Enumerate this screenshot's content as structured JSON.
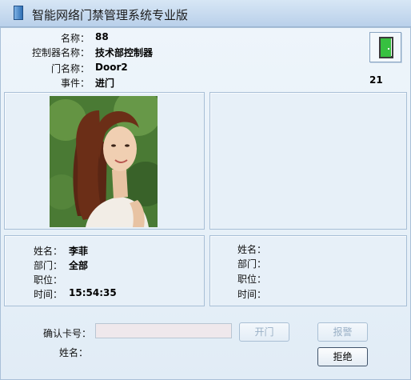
{
  "window": {
    "title": "智能网络门禁管理系统专业版"
  },
  "event": {
    "name_label": "名称：",
    "name_value": "88",
    "controller_label": "控制器名称：",
    "controller_value": "技术部控制器",
    "door_label": "门名称：",
    "door_value": "Door2",
    "event_label": "事件：",
    "event_value": "进门",
    "count": "21",
    "door_icon": "door-open-icon",
    "door_icon_color": "#37c040"
  },
  "person_left": {
    "name_label": "姓名：",
    "name_value": "李菲",
    "dept_label": "部门：",
    "dept_value": "全部",
    "position_label": "职位：",
    "position_value": "",
    "time_label": "时间：",
    "time_value": "15:54:35"
  },
  "person_right": {
    "name_label": "姓名：",
    "name_value": "",
    "dept_label": "部门：",
    "dept_value": "",
    "position_label": "职位：",
    "position_value": "",
    "time_label": "时间：",
    "time_value": ""
  },
  "confirm": {
    "card_label": "确认卡号：",
    "card_value": "",
    "name_label": "姓名：",
    "name_value": "",
    "open_button": "开门",
    "alarm_button": "报警",
    "reject_button": "拒绝"
  }
}
